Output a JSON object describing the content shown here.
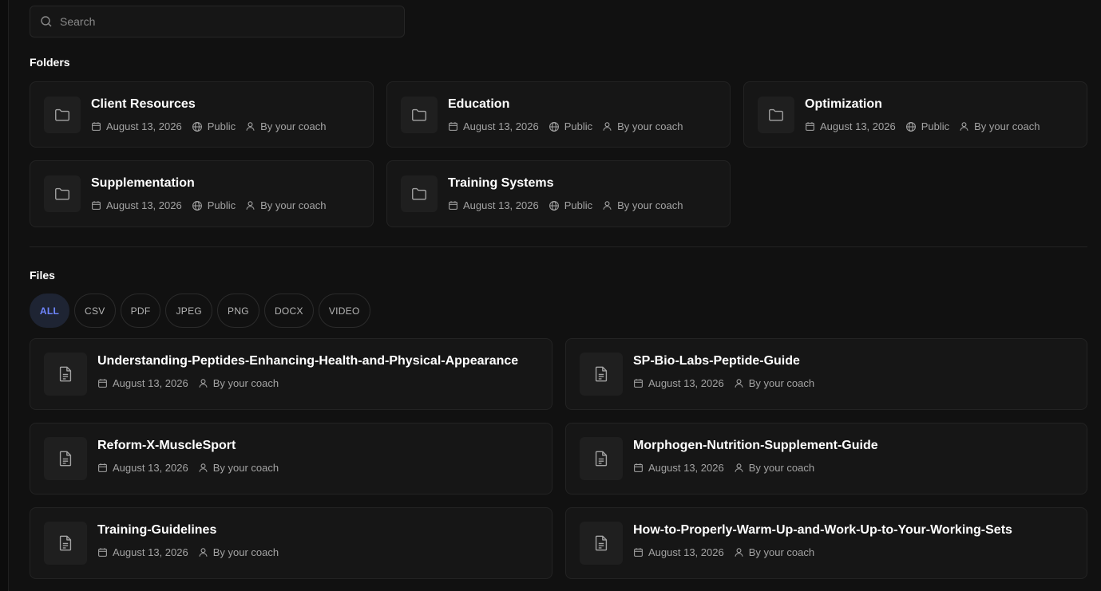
{
  "search": {
    "placeholder": "Search"
  },
  "folders": {
    "title": "Folders",
    "items": [
      {
        "name": "Client Resources",
        "date": "August 13, 2026",
        "visibility": "Public",
        "author": "By your coach"
      },
      {
        "name": "Education",
        "date": "August 13, 2026",
        "visibility": "Public",
        "author": "By your coach"
      },
      {
        "name": "Optimization",
        "date": "August 13, 2026",
        "visibility": "Public",
        "author": "By your coach"
      },
      {
        "name": "Supplementation",
        "date": "August 13, 2026",
        "visibility": "Public",
        "author": "By your coach"
      },
      {
        "name": "Training Systems",
        "date": "August 13, 2026",
        "visibility": "Public",
        "author": "By your coach"
      }
    ]
  },
  "files": {
    "title": "Files",
    "filters": [
      "ALL",
      "CSV",
      "PDF",
      "JPEG",
      "PNG",
      "DOCX",
      "VIDEO"
    ],
    "active_filter": "ALL",
    "items": [
      {
        "name": "Understanding-Peptides-Enhancing-Health-and-Physical-Appearance",
        "date": "August 13, 2026",
        "author": "By your coach"
      },
      {
        "name": "SP-Bio-Labs-Peptide-Guide",
        "date": "August 13, 2026",
        "author": "By your coach"
      },
      {
        "name": "Reform-X-MuscleSport",
        "date": "August 13, 2026",
        "author": "By your coach"
      },
      {
        "name": "Morphogen-Nutrition-Supplement-Guide",
        "date": "August 13, 2026",
        "author": "By your coach"
      },
      {
        "name": "Training-Guidelines",
        "date": "August 13, 2026",
        "author": "By your coach"
      },
      {
        "name": "How-to-Properly-Warm-Up-and-Work-Up-to-Your-Working-Sets",
        "date": "August 13, 2026",
        "author": "By your coach"
      }
    ]
  },
  "colors": {
    "accent": "#6f86ff",
    "card_bg": "#161616",
    "page_bg": "#111111"
  },
  "icons": {
    "search": "search-icon",
    "folder": "folder-icon",
    "file": "file-text-icon",
    "calendar": "calendar-icon",
    "globe": "globe-icon",
    "user": "user-icon"
  }
}
